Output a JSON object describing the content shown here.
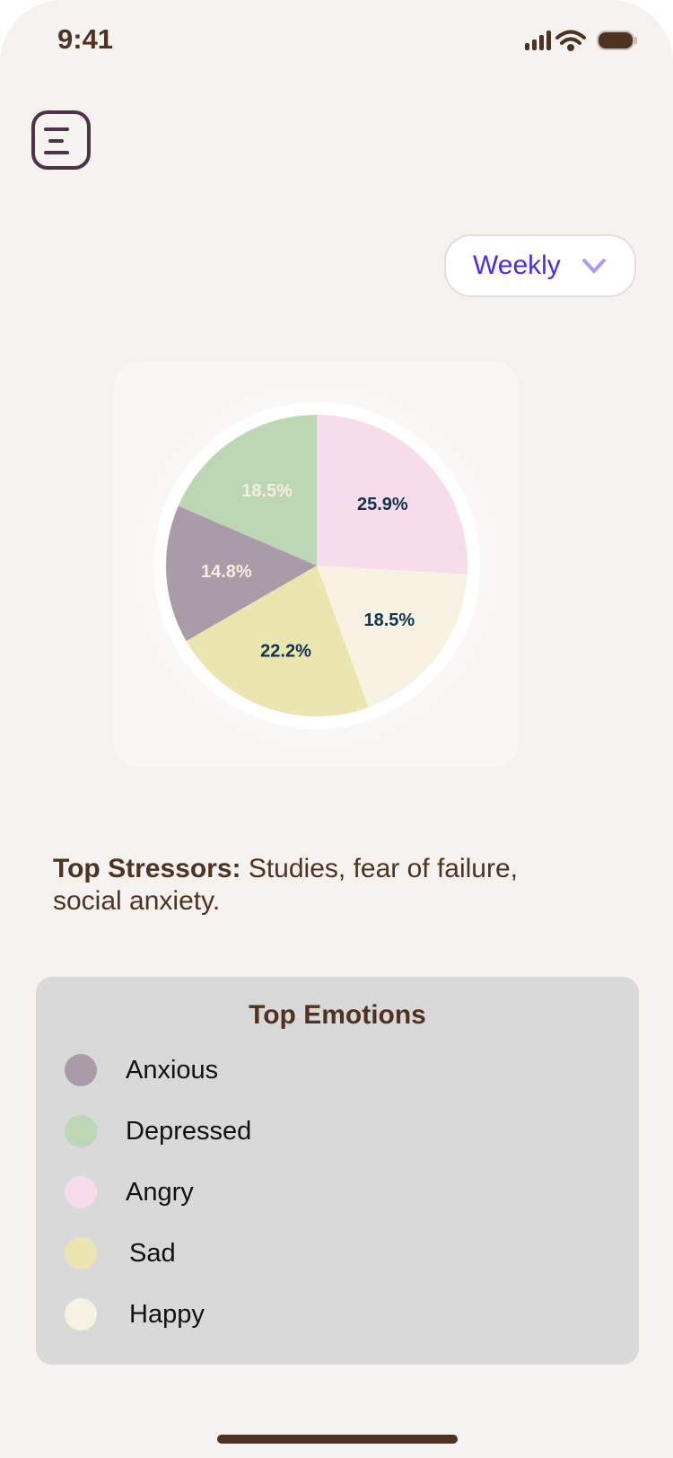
{
  "status_bar": {
    "time": "9:41"
  },
  "filter": {
    "selected": "Weekly"
  },
  "stressors": {
    "label": "Top Stressors:",
    "text": " Studies, fear of failure, social anxiety."
  },
  "legend": {
    "title": "Top Emotions"
  },
  "chart_data": {
    "type": "pie",
    "title": "Top Emotions",
    "categories": [
      "Angry",
      "Happy",
      "Sad",
      "Anxious",
      "Depressed"
    ],
    "values": [
      25.9,
      18.5,
      22.2,
      14.8,
      18.5
    ],
    "labels": [
      "25.9%",
      "18.5%",
      "22.2%",
      "14.8%",
      "18.5%"
    ],
    "colors": [
      "#f7dcec",
      "#f8f2e2",
      "#ebe6b0",
      "#aa9ba9",
      "#bdd6b4"
    ],
    "label_colors": [
      "#0f3350",
      "#0f3350",
      "#0f3350",
      "#f5efe0",
      "#f5efe0"
    ],
    "legend_order": [
      "Anxious",
      "Depressed",
      "Angry",
      "Sad",
      "Happy"
    ],
    "legend_colors": [
      "#aa9ba9",
      "#bdd6b4",
      "#f7dcec",
      "#ebe6b0",
      "#f8f2e2"
    ]
  }
}
